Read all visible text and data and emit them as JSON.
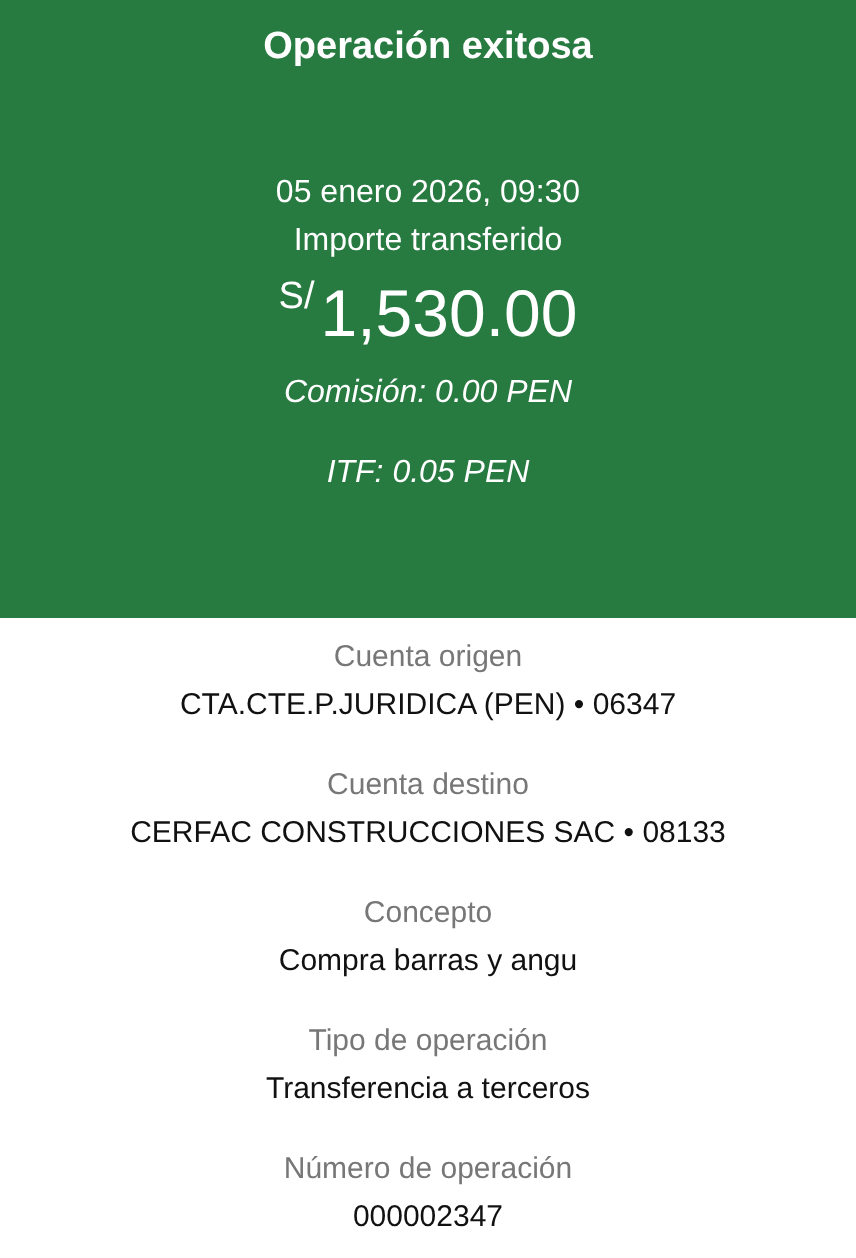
{
  "header": {
    "title": "Operación exitosa",
    "date": "05 enero 2026, 09:30",
    "amount_label": "Importe transferido",
    "currency": "S/",
    "amount": "1,530.00",
    "fees": [
      "Comisión: 0.00 PEN",
      "ITF: 0.05 PEN"
    ]
  },
  "details": [
    {
      "label": "Cuenta origen",
      "value": "CTA.CTE.P.JURIDICA (PEN) • 06347"
    },
    {
      "label": "Cuenta destino",
      "value": "CERFAC CONSTRUCCIONES SAC • 08133"
    },
    {
      "label": "Concepto",
      "value": "Compra barras y angu"
    },
    {
      "label": "Tipo de operación",
      "value": "Transferencia a terceros"
    },
    {
      "label": "Número de operación",
      "value": "000002347"
    }
  ]
}
